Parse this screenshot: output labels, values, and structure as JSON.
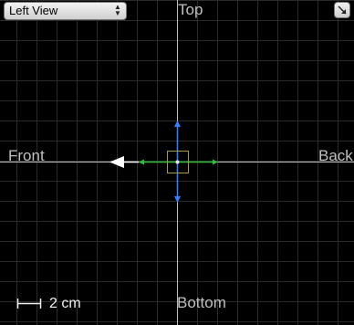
{
  "toolbar": {
    "view_select": {
      "value": "Left View"
    }
  },
  "labels": {
    "top": "Top",
    "bottom": "Bottom",
    "front": "Front",
    "back": "Back"
  },
  "scale_bar": {
    "label": "2 cm"
  },
  "icons": {
    "view_select_arrows": "updown-arrows-icon",
    "maximize": "maximize-icon",
    "scale": "scale-bar-icon"
  },
  "colors": {
    "grid": "#2b2b2b",
    "axis": "#bfbfbf",
    "up_arrow": "#3a7fff",
    "side_arrow": "#2fbf3f",
    "pivot_box": "#a89a4a",
    "front_arrow": "#ffffff"
  }
}
